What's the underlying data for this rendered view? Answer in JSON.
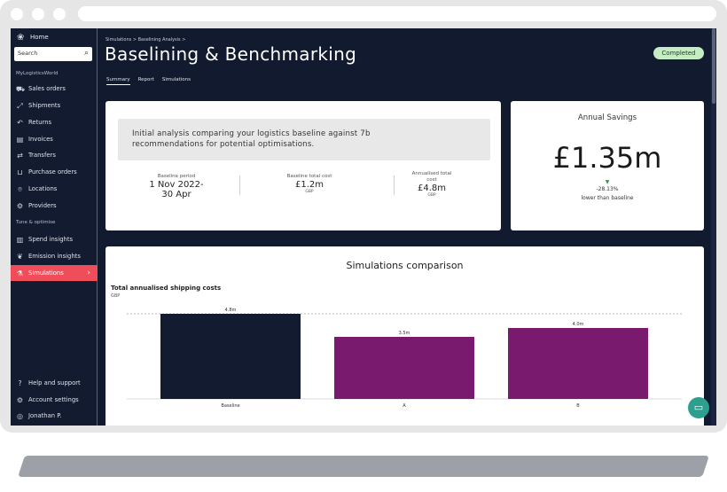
{
  "sidebar": {
    "home": "Home",
    "search_placeholder": "Search",
    "org": "MyLogisticsWorld",
    "items": [
      {
        "label": "Sales orders",
        "icon": "cart-icon"
      },
      {
        "label": "Shipments",
        "icon": "expand-icon"
      },
      {
        "label": "Returns",
        "icon": "returns-icon"
      },
      {
        "label": "Invoices",
        "icon": "invoice-icon"
      },
      {
        "label": "Transfers",
        "icon": "transfer-icon"
      },
      {
        "label": "Purchase orders",
        "icon": "basket-icon"
      },
      {
        "label": "Locations",
        "icon": "pin-icon"
      },
      {
        "label": "Providers",
        "icon": "providers-icon"
      }
    ],
    "section2": "Tune & optimise",
    "items2": [
      {
        "label": "Spend insights",
        "icon": "chart-icon"
      },
      {
        "label": "Emission insights",
        "icon": "leaf-icon"
      },
      {
        "label": "Simulations",
        "icon": "flask-icon"
      }
    ],
    "footer": [
      {
        "label": "Help and support",
        "icon": "help-icon"
      },
      {
        "label": "Account settings",
        "icon": "gear-icon"
      },
      {
        "label": "Jonathan P.",
        "icon": "compass-icon"
      }
    ]
  },
  "header": {
    "breadcrumb": "Simulations > Baselining Analysis >",
    "title": "Baselining & Benchmarking",
    "status": "Completed",
    "tabs": [
      "Summary",
      "Report",
      "Simulations"
    ]
  },
  "summary": {
    "intro_line1": "Initial analysis comparing your logistics baseline against 7b",
    "intro_line2": "recommendations for potential optimisations.",
    "baseline_period_label": "Baseline period",
    "baseline_period_line1": "1 Nov 2022-",
    "baseline_period_line2": "30 Apr",
    "baseline_cost_label": "Baseline total cost",
    "baseline_cost_value": "£1.2m",
    "baseline_cost_unit": "GBP",
    "annualised_label_line1": "Annualised total",
    "annualised_label_line2": "cost",
    "annualised_value": "£4.8m",
    "annualised_unit": "GBP"
  },
  "savings": {
    "title": "Annual Savings",
    "amount": "£1.35m",
    "arrow": "▼",
    "percent": "-28.13%",
    "note": "lower than baseline"
  },
  "comparison": {
    "title": "Simulations comparison"
  },
  "chart_data": {
    "type": "bar",
    "title": "Total annualised shipping costs",
    "ylabel": "GBP",
    "categories": [
      "Baseline",
      "A",
      "B"
    ],
    "values": [
      4.8,
      3.5,
      4.0
    ],
    "value_labels": [
      "4.8m",
      "3.5m",
      "4.0m"
    ],
    "colors": [
      "#121b30",
      "#7a1a6e",
      "#7a1a6e"
    ],
    "ylim": [
      0,
      6.0
    ],
    "reference_line": 4.8
  },
  "colors": {
    "sidebar_bg": "#121b30",
    "active": "#f04d5b",
    "badge": "#c6ecc4",
    "chat": "#2d9f8f"
  }
}
